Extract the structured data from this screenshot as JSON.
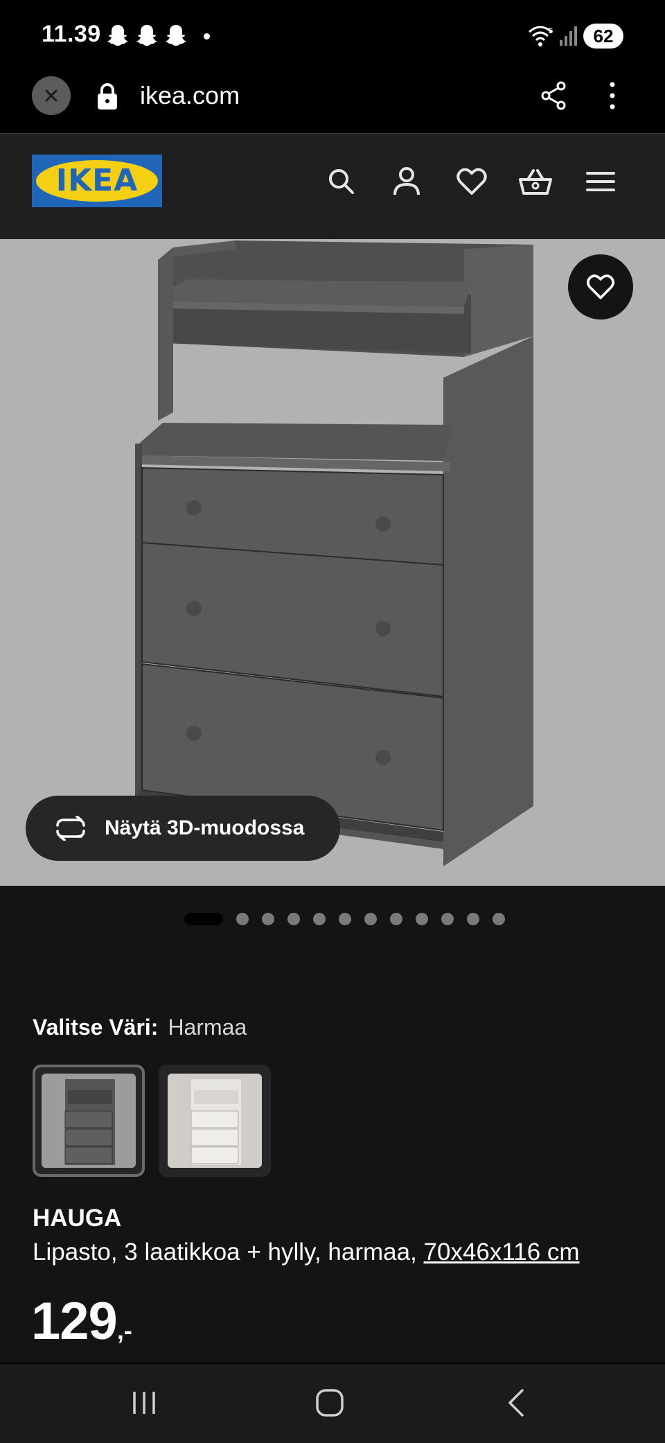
{
  "status_bar": {
    "time": "11.39",
    "notification_icons": [
      "snapchat-icon",
      "snapchat-icon",
      "snapchat-icon"
    ],
    "battery": "62"
  },
  "browser": {
    "url": "ikea.com"
  },
  "header": {
    "logo_text": "IKEA",
    "icons": [
      "search-icon",
      "account-icon",
      "wishlist-icon",
      "basket-icon",
      "menu-icon"
    ]
  },
  "gallery": {
    "view_3d_label": "Näytä 3D-muodossa",
    "image_count": 12,
    "active_index": 0
  },
  "color_selector": {
    "label": "Valitse Väri:",
    "selected": "Harmaa",
    "options": [
      "dark-grey",
      "white"
    ]
  },
  "product": {
    "name": "HAUGA",
    "description": "Lipasto, 3 laatikkoa + hylly, harmaa, ",
    "dimensions": "70x46x116 cm",
    "price": "129",
    "price_suffix": ",-"
  },
  "colors": {
    "ikea_blue": "#1f66b8",
    "ikea_yellow": "#f4cf13",
    "background": "#141414"
  }
}
